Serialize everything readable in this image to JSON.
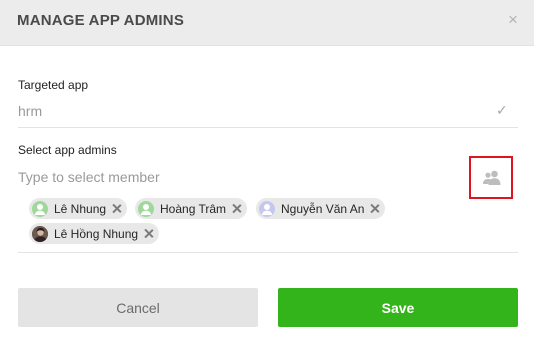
{
  "dialog": {
    "title": "MANAGE APP ADMINS",
    "close_icon": "close-icon"
  },
  "targeted_app": {
    "label": "Targeted app",
    "value": "hrm",
    "status_icon": "check-icon"
  },
  "admins": {
    "label": "Select app admins",
    "placeholder": "Type to select member",
    "member_picker_icon": "user-group-icon",
    "selected": [
      {
        "name": "Lê Nhung",
        "avatar": "default-user-avatar",
        "avatar_color": "#9fd89a"
      },
      {
        "name": "Hoàng Trâm",
        "avatar": "default-user-avatar",
        "avatar_color": "#9fd89a"
      },
      {
        "name": "Nguyễn Văn An",
        "avatar": "default-user-avatar",
        "avatar_color": "#c4c8ee"
      },
      {
        "name": "Lê Hồng Nhung",
        "avatar": "photo-avatar",
        "avatar_color": "#5a4a44"
      }
    ]
  },
  "actions": {
    "cancel_label": "Cancel",
    "save_label": "Save"
  },
  "colors": {
    "save": "#32b41a",
    "cancel": "#e4e4e4",
    "highlight": "#e0141e",
    "header": "#ececec"
  }
}
